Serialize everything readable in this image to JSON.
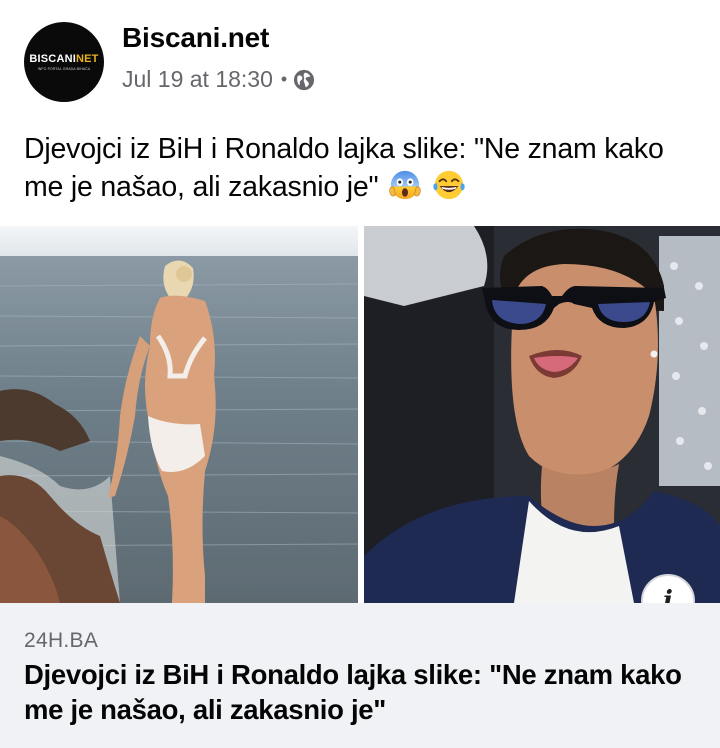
{
  "post": {
    "page_name": "Biscani.net",
    "timestamp": "Jul 19 at 18:30",
    "separator": "•",
    "audience_icon": "globe-icon",
    "text": "Djevojci iz BiH i Ronaldo lajka slike: \"Ne znam kako me je našao, ali zakasnio je\"",
    "emojis": [
      "face-screaming-in-fear-emoji",
      "face-with-tears-of-joy-emoji"
    ]
  },
  "avatar": {
    "brand_main": "BISCANI",
    "brand_accent": "NET",
    "tagline": "INFO PORTAL GRADA BIHAĆA",
    "brand_accent_color": "#e8b320"
  },
  "info_button": {
    "label": "i"
  },
  "link_preview": {
    "domain": "24H.BA",
    "title": "Djevojci iz BiH i Ronaldo lajka slike: \"Ne znam kako me je našao, ali zakasnio je\""
  },
  "colors": {
    "secondary_text": "#65676b",
    "preview_background": "#f0f2f5"
  }
}
